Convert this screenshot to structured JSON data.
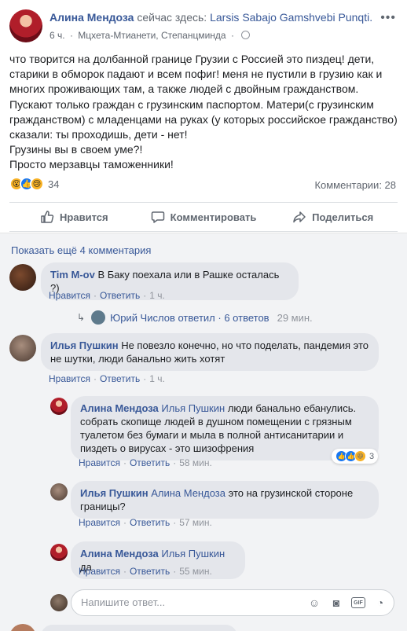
{
  "post": {
    "author": "Алина Мендоза",
    "action": "сейчас здесь:",
    "page": "Larsis Sabajo Gamshvebi Punqti.",
    "time": "6 ч.",
    "location": "Мцхета-Мтианети, Степанцминда",
    "text": [
      "что творится на долбанной границе Грузии с Россией это пиздец! дети, старики в обморок падают и всем пофиг! меня не пустили в грузию как и многих проживающих там, а также людей с двойным гражданством. Пускают только граждан с грузинским паспортом. Матери(с грузинским гражданством) с младенцами на руках (у которых российское гражданство) сказали: ты проходишь, дети - нет!",
      "Грузины вы в своем уме?!",
      "Просто мерзавцы таможенники!"
    ],
    "reaction_count": "34",
    "comments_count": "Комментарии: 28",
    "reactions": [
      "wow-icon",
      "like-icon",
      "sad-icon"
    ]
  },
  "actions": {
    "like": "Нравится",
    "comment": "Комментировать",
    "share": "Поделиться"
  },
  "comments_section": {
    "show_more": "Показать ещё 4 комментария",
    "like_label": "Нравится",
    "reply_label": "Ответить",
    "dot": "·"
  },
  "comments": [
    {
      "author": "Tim M-ov",
      "text": "В Баку поехала или в Рашке осталась ?)",
      "time": "1 ч."
    },
    {
      "author": "Илья Пушкин",
      "text": "Не повезло конечно, но что поделать, пандемия это не шутки, люди банально жить хотят",
      "time": "1 ч."
    }
  ],
  "reply_summary": {
    "author": "Юрий Числов",
    "text": "ответил",
    "count": "6 ответов",
    "time": "29 мин."
  },
  "replies": [
    {
      "author": "Алина Мендоза",
      "mention": "Илья Пушкин",
      "text": "люди банально ебанулись. собрать скопище людей в душном помещении с грязным туалетом без бумаги и мыла в полной антисанитарии и пиздеть о вирусах - это шизофрения",
      "time": "58 мин.",
      "reaction_count": "3"
    },
    {
      "author": "Илья Пушкин",
      "mention": "Алина Мендоза",
      "text": "это на грузинской стороне границы?",
      "time": "57 мин."
    },
    {
      "author": "Алина Мендоза",
      "mention": "Илья Пушкин",
      "text": "да",
      "time": "55 мин."
    }
  ],
  "composer": {
    "placeholder": "Напишите ответ..."
  }
}
